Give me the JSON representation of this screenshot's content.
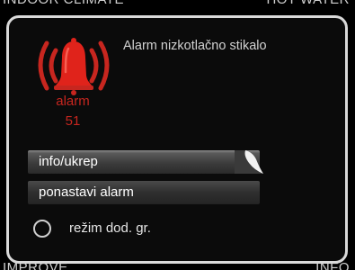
{
  "background": {
    "top_left_text": "INDOOR CLIMATE",
    "top_right_text": "HOT WATER",
    "bottom_left_text": "IMPROVE",
    "bottom_right_text": "INFO"
  },
  "alarm": {
    "title": "Alarm nizkotlačno stikalo",
    "label": "alarm",
    "code": "51",
    "icon": "alarm-bell-icon",
    "color": "#c7261f"
  },
  "menu": {
    "items": [
      {
        "label": "info/ukrep",
        "selected": true
      },
      {
        "label": "ponastavi alarm",
        "selected": false
      }
    ],
    "radio_option": {
      "label": "režim dod. gr.",
      "checked": false
    }
  }
}
